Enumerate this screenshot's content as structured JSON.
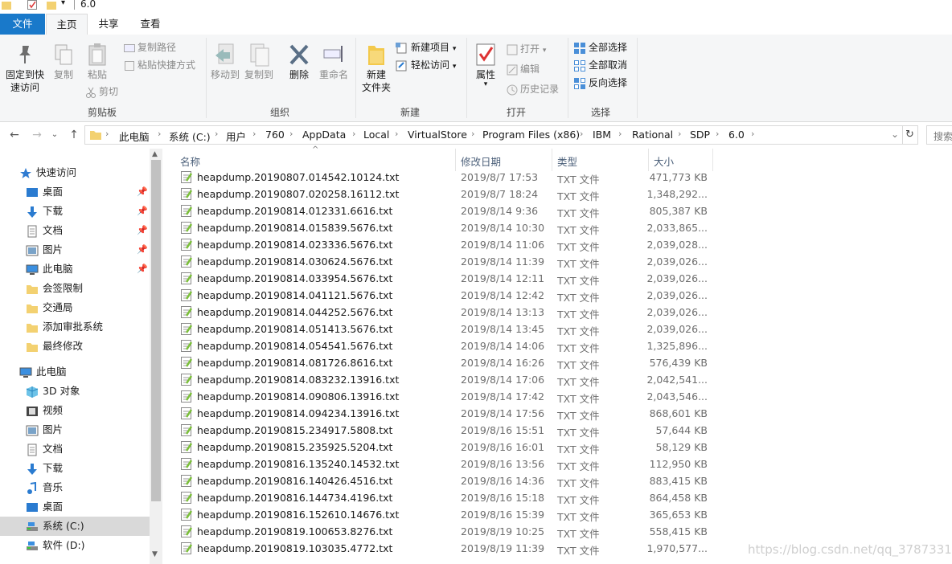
{
  "window": {
    "title": "6.0"
  },
  "tabs": [
    {
      "label": "文件",
      "kind": "file"
    },
    {
      "label": "主页",
      "kind": "active"
    },
    {
      "label": "共享",
      "kind": "normal"
    },
    {
      "label": "查看",
      "kind": "normal"
    }
  ],
  "ribbon": {
    "clipboard": {
      "group_label": "剪贴板",
      "pin_label_1": "固定到快",
      "pin_label_2": "速访问",
      "copy": "复制",
      "paste": "粘贴",
      "copy_path": "复制路径",
      "paste_shortcut": "粘贴快捷方式",
      "cut": "剪切"
    },
    "organize": {
      "group_label": "组织",
      "move_to": "移动到",
      "copy_to": "复制到",
      "delete": "删除",
      "rename": "重命名"
    },
    "new": {
      "group_label": "新建",
      "new_folder_1": "新建",
      "new_folder_2": "文件夹",
      "new_item": "新建项目",
      "easy_access": "轻松访问"
    },
    "open": {
      "group_label": "打开",
      "properties": "属性",
      "open": "打开",
      "edit": "编辑",
      "history": "历史记录"
    },
    "select": {
      "group_label": "选择",
      "select_all": "全部选择",
      "select_none": "全部取消",
      "invert": "反向选择"
    }
  },
  "address": {
    "crumbs": [
      "此电脑",
      "系统 (C:)",
      "用户",
      "760",
      "AppData",
      "Local",
      "VirtualStore",
      "Program Files (x86)",
      "IBM",
      "Rational",
      "SDP",
      "6.0"
    ],
    "search_placeholder": "搜索"
  },
  "nav": {
    "items": [
      {
        "label": "快速访问",
        "icon": "star-icon",
        "pinned": false
      },
      {
        "label": "桌面",
        "icon": "desktop-icon",
        "pinned": true
      },
      {
        "label": "下载",
        "icon": "download-icon",
        "pinned": true
      },
      {
        "label": "文档",
        "icon": "document-icon",
        "pinned": true
      },
      {
        "label": "图片",
        "icon": "picture-icon",
        "pinned": true
      },
      {
        "label": "此电脑",
        "icon": "computer-icon",
        "pinned": true
      },
      {
        "label": "会签限制",
        "icon": "folder-icon",
        "pinned": false
      },
      {
        "label": "交通局",
        "icon": "folder-icon",
        "pinned": false
      },
      {
        "label": "添加审批系统",
        "icon": "folder-icon",
        "pinned": false
      },
      {
        "label": "最终修改",
        "icon": "folder-icon",
        "pinned": false
      },
      {
        "label": "此电脑",
        "icon": "computer-icon",
        "pinned": false
      },
      {
        "label": "3D 对象",
        "icon": "cube-icon",
        "pinned": false
      },
      {
        "label": "视频",
        "icon": "video-icon",
        "pinned": false
      },
      {
        "label": "图片",
        "icon": "picture-icon",
        "pinned": false
      },
      {
        "label": "文档",
        "icon": "document-icon",
        "pinned": false
      },
      {
        "label": "下载",
        "icon": "download-icon",
        "pinned": false
      },
      {
        "label": "音乐",
        "icon": "music-icon",
        "pinned": false
      },
      {
        "label": "桌面",
        "icon": "desktop-icon",
        "pinned": false
      },
      {
        "label": "系统 (C:)",
        "icon": "drive-icon",
        "pinned": false
      },
      {
        "label": "软件 (D:)",
        "icon": "drive-icon",
        "pinned": false
      }
    ]
  },
  "list": {
    "columns": {
      "name": "名称",
      "date": "修改日期",
      "type": "类型",
      "size": "大小"
    },
    "files": [
      {
        "name": "heapdump.20190807.014542.10124.txt",
        "date": "2019/8/7 17:53",
        "type": "TXT 文件",
        "size": "471,773 KB"
      },
      {
        "name": "heapdump.20190807.020258.16112.txt",
        "date": "2019/8/7 18:24",
        "type": "TXT 文件",
        "size": "1,348,292..."
      },
      {
        "name": "heapdump.20190814.012331.6616.txt",
        "date": "2019/8/14 9:36",
        "type": "TXT 文件",
        "size": "805,387 KB"
      },
      {
        "name": "heapdump.20190814.015839.5676.txt",
        "date": "2019/8/14 10:30",
        "type": "TXT 文件",
        "size": "2,033,865..."
      },
      {
        "name": "heapdump.20190814.023336.5676.txt",
        "date": "2019/8/14 11:06",
        "type": "TXT 文件",
        "size": "2,039,028..."
      },
      {
        "name": "heapdump.20190814.030624.5676.txt",
        "date": "2019/8/14 11:39",
        "type": "TXT 文件",
        "size": "2,039,026..."
      },
      {
        "name": "heapdump.20190814.033954.5676.txt",
        "date": "2019/8/14 12:11",
        "type": "TXT 文件",
        "size": "2,039,026..."
      },
      {
        "name": "heapdump.20190814.041121.5676.txt",
        "date": "2019/8/14 12:42",
        "type": "TXT 文件",
        "size": "2,039,026..."
      },
      {
        "name": "heapdump.20190814.044252.5676.txt",
        "date": "2019/8/14 13:13",
        "type": "TXT 文件",
        "size": "2,039,026..."
      },
      {
        "name": "heapdump.20190814.051413.5676.txt",
        "date": "2019/8/14 13:45",
        "type": "TXT 文件",
        "size": "2,039,026..."
      },
      {
        "name": "heapdump.20190814.054541.5676.txt",
        "date": "2019/8/14 14:06",
        "type": "TXT 文件",
        "size": "1,325,896..."
      },
      {
        "name": "heapdump.20190814.081726.8616.txt",
        "date": "2019/8/14 16:26",
        "type": "TXT 文件",
        "size": "576,439 KB"
      },
      {
        "name": "heapdump.20190814.083232.13916.txt",
        "date": "2019/8/14 17:06",
        "type": "TXT 文件",
        "size": "2,042,541..."
      },
      {
        "name": "heapdump.20190814.090806.13916.txt",
        "date": "2019/8/14 17:42",
        "type": "TXT 文件",
        "size": "2,043,546..."
      },
      {
        "name": "heapdump.20190814.094234.13916.txt",
        "date": "2019/8/14 17:56",
        "type": "TXT 文件",
        "size": "868,601 KB"
      },
      {
        "name": "heapdump.20190815.234917.5808.txt",
        "date": "2019/8/16 15:51",
        "type": "TXT 文件",
        "size": "57,644 KB"
      },
      {
        "name": "heapdump.20190815.235925.5204.txt",
        "date": "2019/8/16 16:01",
        "type": "TXT 文件",
        "size": "58,129 KB"
      },
      {
        "name": "heapdump.20190816.135240.14532.txt",
        "date": "2019/8/16 13:56",
        "type": "TXT 文件",
        "size": "112,950 KB"
      },
      {
        "name": "heapdump.20190816.140426.4516.txt",
        "date": "2019/8/16 14:36",
        "type": "TXT 文件",
        "size": "883,415 KB"
      },
      {
        "name": "heapdump.20190816.144734.4196.txt",
        "date": "2019/8/16 15:18",
        "type": "TXT 文件",
        "size": "864,458 KB"
      },
      {
        "name": "heapdump.20190816.152610.14676.txt",
        "date": "2019/8/16 15:39",
        "type": "TXT 文件",
        "size": "365,653 KB"
      },
      {
        "name": "heapdump.20190819.100653.8276.txt",
        "date": "2019/8/19 10:25",
        "type": "TXT 文件",
        "size": "558,415 KB"
      },
      {
        "name": "heapdump.20190819.103035.4772.txt",
        "date": "2019/8/19 11:39",
        "type": "TXT 文件",
        "size": "1,970,577..."
      }
    ]
  },
  "watermark": "https://blog.csdn.net/qq_37873314",
  "colors": {
    "accent": "#1979ca",
    "folder": "#f3d171",
    "selection": "#d9d9d9"
  }
}
